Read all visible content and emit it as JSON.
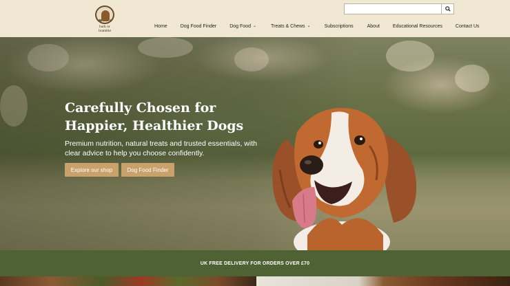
{
  "brand": {
    "logo_text_line1": "bark or",
    "logo_text_line2": "bramble"
  },
  "search": {
    "placeholder": "",
    "value": "",
    "icon": "search-icon"
  },
  "nav": {
    "items": [
      {
        "label": "Home",
        "dropdown": false
      },
      {
        "label": "Dog Food Finder",
        "dropdown": false
      },
      {
        "label": "Dog Food",
        "dropdown": true
      },
      {
        "label": "Treats & Chews",
        "dropdown": true
      },
      {
        "label": "Subscriptions",
        "dropdown": false
      },
      {
        "label": "About",
        "dropdown": false
      },
      {
        "label": "Educational Resources",
        "dropdown": false
      },
      {
        "label": "Contact Us",
        "dropdown": false
      }
    ]
  },
  "hero": {
    "title": "Carefully Chosen for Happier, Healthier Dogs",
    "subtitle": "Premium nutrition, natural treats and trusted essentials, with clear advice to help you choose confidently.",
    "buttons": {
      "shop": "Explore our shop",
      "finder": "Dog Food Finder"
    }
  },
  "banner": {
    "text": "UK FREE DELIVERY FOR ORDERS OVER £70"
  },
  "colors": {
    "header_bg": "#f0e8d2",
    "accent_button": "#c9a16a",
    "banner_bg": "#4e6233"
  }
}
